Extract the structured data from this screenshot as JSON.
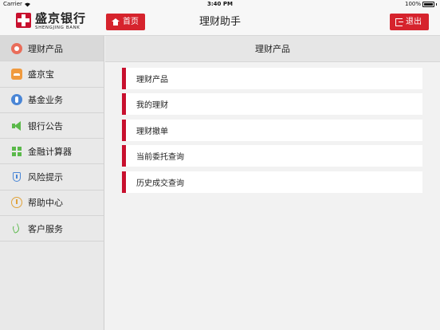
{
  "statusbar": {
    "carrier": "Carrier",
    "time": "3:40 PM",
    "battery": "100%"
  },
  "header": {
    "logo_cn": "盛京银行",
    "logo_en": "SHENGJING BANK",
    "home_label": "首页",
    "title": "理财助手",
    "exit_label": "退出"
  },
  "sidebar": {
    "items": [
      {
        "label": "理财产品",
        "icon": "wealth-product-icon"
      },
      {
        "label": "盛京宝",
        "icon": "shengjingbao-icon"
      },
      {
        "label": "基金业务",
        "icon": "fund-icon"
      },
      {
        "label": "银行公告",
        "icon": "megaphone-icon"
      },
      {
        "label": "金融计算器",
        "icon": "calculator-icon"
      },
      {
        "label": "风险提示",
        "icon": "shield-icon"
      },
      {
        "label": "帮助中心",
        "icon": "help-icon"
      },
      {
        "label": "客户服务",
        "icon": "phone-icon"
      }
    ],
    "active_index": 0
  },
  "content": {
    "title": "理财产品",
    "menu": [
      {
        "label": "理财产品"
      },
      {
        "label": "我的理财"
      },
      {
        "label": "理财撤单"
      },
      {
        "label": "当前委托查询"
      },
      {
        "label": "历史成交查询"
      }
    ]
  },
  "colors": {
    "brand_red": "#c8102e",
    "button_red": "#d6232d"
  }
}
